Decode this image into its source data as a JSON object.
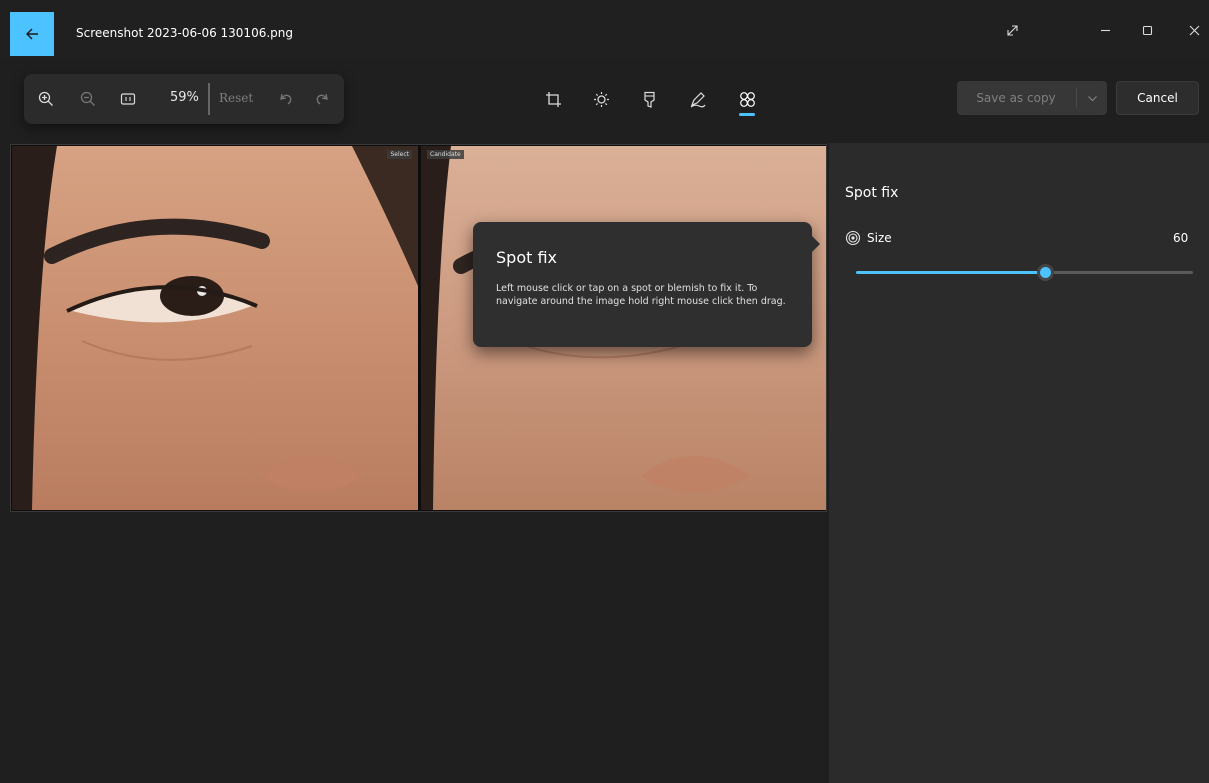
{
  "window": {
    "title": "Screenshot 2023-06-06 130106.png"
  },
  "zoom_toolbar": {
    "zoom_level": "59%",
    "reset_label": "Reset"
  },
  "edit_tools": [
    "crop-icon",
    "adjust-icon",
    "filter-icon",
    "markup-icon",
    "spot-fix-icon"
  ],
  "active_tool": "spot-fix-icon",
  "actions": {
    "save_label": "Save as copy",
    "cancel_label": "Cancel"
  },
  "photos": {
    "left_tag": "Select",
    "right_tag": "Candidate"
  },
  "tooltip": {
    "title": "Spot fix",
    "body": "Left mouse click or tap on a spot or blemish to fix it. To navigate around the image hold right mouse click then drag."
  },
  "panel": {
    "title": "Spot fix",
    "size_label": "Size",
    "size_value": "60",
    "size_fraction": 0.56
  },
  "colors": {
    "accent": "#4cc2ff",
    "background": "#1f1f1f",
    "panel": "#2b2b2b"
  }
}
